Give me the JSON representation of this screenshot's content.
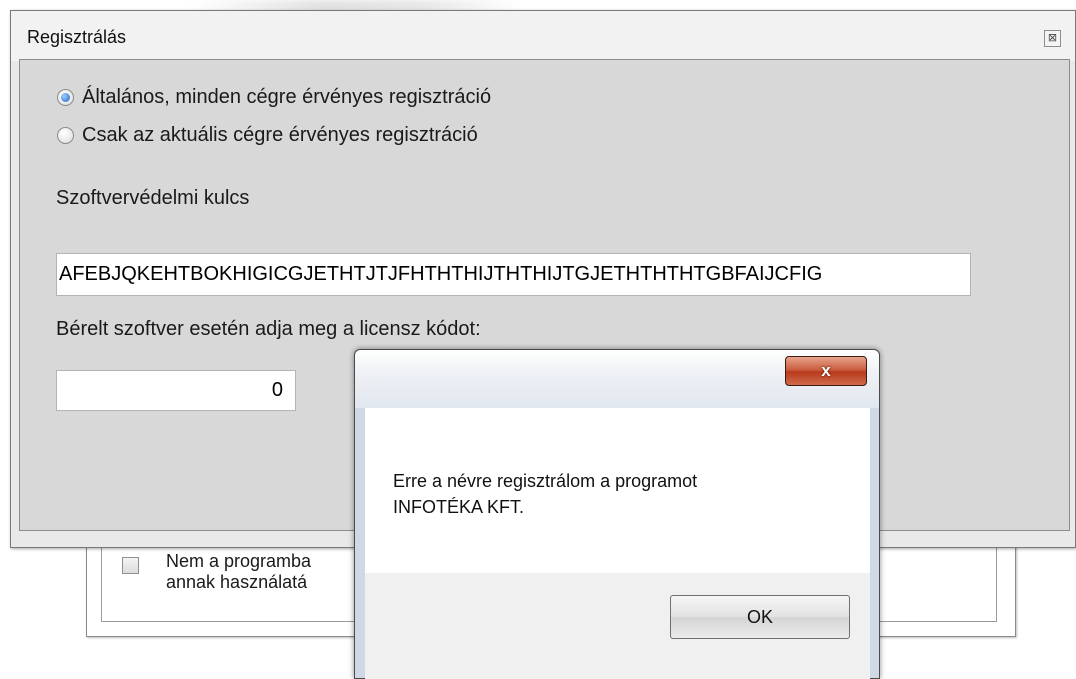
{
  "background_window": {
    "checkbox_text_line1": "Nem a programba",
    "checkbox_text_line2": "annak használatá"
  },
  "main_dialog": {
    "title": "Regisztrálás",
    "close_glyph": "⊠",
    "radio_general": "Általános, minden cégre érvényes regisztráció",
    "radio_current": "Csak az aktuális cégre érvényes regisztráció",
    "selected_radio": "general",
    "key_label": "Szoftvervédelmi kulcs",
    "key_value": "AFEBJQKEHTBOKHIGICGJETHTJTJFHTHTHIJTHTHIJTGJETHTHTHTGBFAIJCFIG",
    "license_label": "Bérelt szoftver esetén adja meg a licensz kódot:",
    "license_value": "0"
  },
  "message_box": {
    "close_glyph": "x",
    "line1": "Erre a névre regisztrálom a programot",
    "line2": "INFOTÉKA KFT.",
    "ok_label": "OK"
  }
}
